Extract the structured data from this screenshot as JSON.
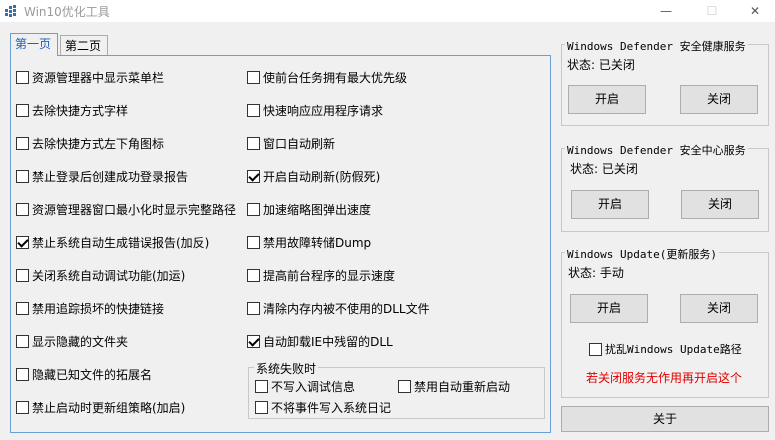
{
  "window": {
    "title": "Win10优化工具",
    "minimize": "—",
    "maximize": "☐",
    "close": "✕"
  },
  "tabs": [
    {
      "label": "第一页",
      "active": true
    },
    {
      "label": "第二页",
      "active": false
    }
  ],
  "options_left": [
    {
      "label": "资源管理器中显示菜单栏",
      "checked": false
    },
    {
      "label": "去除快捷方式字样",
      "checked": false
    },
    {
      "label": "去除快捷方式左下角图标",
      "checked": false
    },
    {
      "label": "禁止登录后创建成功登录报告",
      "checked": false
    },
    {
      "label": "资源管理器窗口最小化时显示完整路径",
      "checked": false
    },
    {
      "label": "禁止系统自动生成错误报告(加反)",
      "checked": true
    },
    {
      "label": "关闭系统自动调试功能(加运)",
      "checked": false
    },
    {
      "label": "禁用追踪损坏的快捷链接",
      "checked": false
    },
    {
      "label": "显示隐藏的文件夹",
      "checked": false
    },
    {
      "label": "隐藏已知文件的拓展名",
      "checked": false
    },
    {
      "label": "禁止启动时更新组策略(加启)",
      "checked": false
    }
  ],
  "options_right": [
    {
      "label": "使前台任务拥有最大优先级",
      "checked": false
    },
    {
      "label": "快速响应应用程序请求",
      "checked": false
    },
    {
      "label": "窗口自动刷新",
      "checked": false
    },
    {
      "label": "开启自动刷新(防假死)",
      "checked": true
    },
    {
      "label": "加速缩略图弹出速度",
      "checked": false
    },
    {
      "label": "禁用故障转储Dump",
      "checked": false
    },
    {
      "label": "提高前台程序的显示速度",
      "checked": false
    },
    {
      "label": "清除内存内被不使用的DLL文件",
      "checked": false
    },
    {
      "label": "自动卸载IE中残留的DLL",
      "checked": true
    }
  ],
  "system_failure": {
    "title": "系统失败时",
    "options": [
      {
        "label": "不写入调试信息",
        "checked": false
      },
      {
        "label": "禁用自动重新启动",
        "checked": false
      },
      {
        "label": "不将事件写入系统日记",
        "checked": false
      }
    ]
  },
  "services": [
    {
      "title": "Windows Defender 安全健康服务",
      "status": "状态: 已关闭",
      "enable_label": "开启",
      "disable_label": "关闭"
    },
    {
      "title": "Windows Defender 安全中心服务",
      "status": "状态: 已关闭",
      "enable_label": "开启",
      "disable_label": "关闭"
    },
    {
      "title": "Windows Update(更新服务)",
      "status": "状态: 手动",
      "enable_label": "开启",
      "disable_label": "关闭"
    }
  ],
  "update_path": {
    "label": "扰乱Windows Update路径",
    "checked": false
  },
  "warning": "若关闭服务无作用再开启这个",
  "about_label": "关于",
  "colors": {
    "accent": "#6a9fd4",
    "warning": "#e00000"
  }
}
